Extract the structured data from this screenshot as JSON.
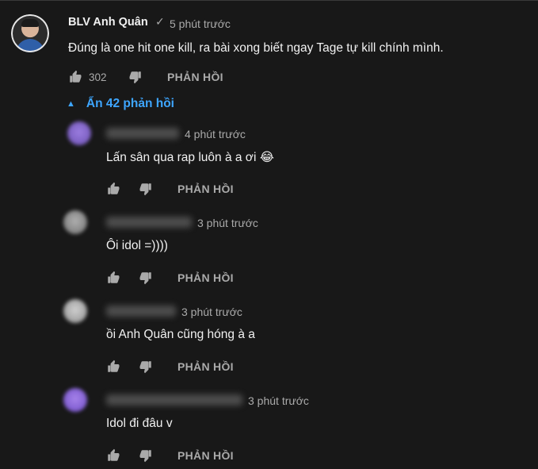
{
  "comment": {
    "author": "BLV Anh Quân",
    "verified_icon": "✓",
    "time": "5 phút trước",
    "text": "Đúng là one hit one kill, ra bài xong biết ngay Tage tự kill chính mình.",
    "likes": "302",
    "reply_label": "PHẢN HỒI"
  },
  "toggle": {
    "caret": "▲",
    "label": "Ẩn 42 phản hồi"
  },
  "replies": [
    {
      "time": "4 phút trước",
      "text": "Lấn sân qua rap luôn à a ơi 😂",
      "reply_label": "PHẢN HỒI",
      "avatar_color": "#7d5fc4"
    },
    {
      "time": "3 phút trước",
      "text": "Ôi idol =))))",
      "reply_label": "PHẢN HỒI",
      "avatar_color": "#8e8e8e"
    },
    {
      "time": "3 phút trước",
      "text": "ồi Anh Quân cũng hóng à a",
      "reply_label": "PHẢN HỒI",
      "avatar_color": "#a9a9a9"
    },
    {
      "time": "3 phút trước",
      "text": "Idol đi đâu v",
      "reply_label": "PHẢN HỒI",
      "avatar_color": "#8a63d2"
    }
  ],
  "colors": {
    "background": "#181818",
    "text": "#f1f1f1",
    "muted": "#aaaaaa",
    "link": "#3ea6ff"
  },
  "icons": {
    "like": "thumb-up-icon",
    "dislike": "thumb-down-icon"
  }
}
